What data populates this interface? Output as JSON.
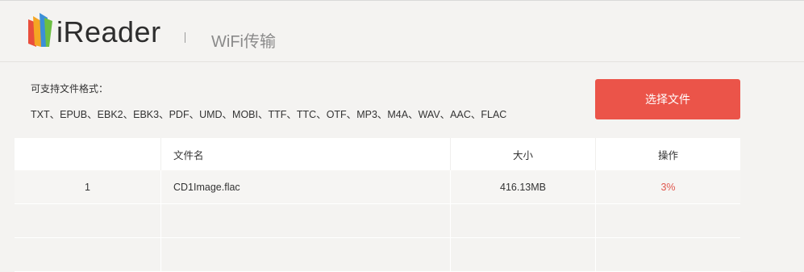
{
  "header": {
    "logo_text": "iReader",
    "page_title": "WiFi传输",
    "logo_colors": [
      "#e94e3c",
      "#f5a623",
      "#3b8fd8",
      "#6cbf43"
    ]
  },
  "formats": {
    "label": "可支持文件格式：",
    "list": "TXT、EPUB、EBK2、EBK3、PDF、UMD、MOBI、TTF、TTC、OTF、MP3、M4A、WAV、AAC、FLAC"
  },
  "choose_button": {
    "label": "选择文件",
    "color": "#eb5449"
  },
  "table": {
    "columns": [
      "",
      "文件名",
      "大小",
      "操作"
    ],
    "rows": [
      {
        "index": "1",
        "name": "CD1Image.flac",
        "size": "416.13MB",
        "progress": "3%"
      }
    ],
    "accent": "#e0584e"
  }
}
